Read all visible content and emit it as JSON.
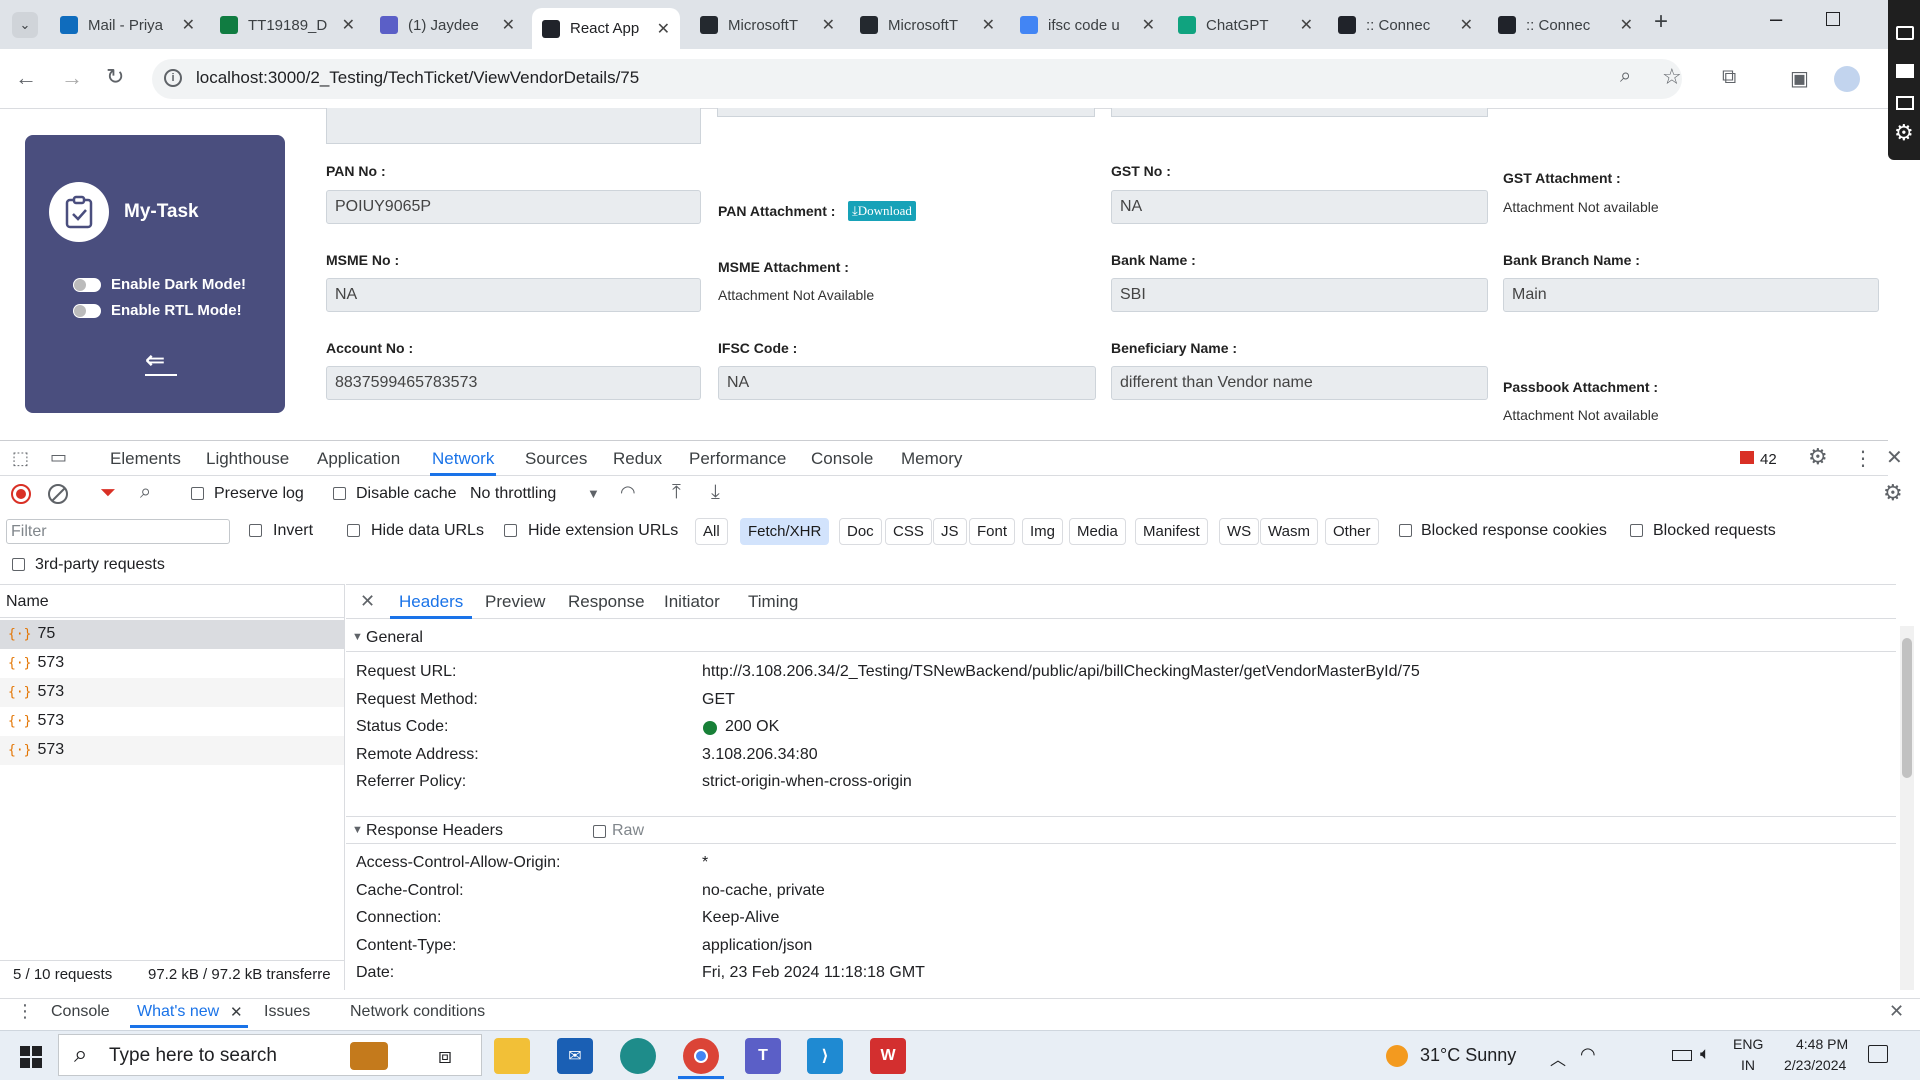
{
  "browser": {
    "tabs": [
      {
        "title": "Mail - Priya",
        "icon": "outlook-icon",
        "color": "#0f6cbd"
      },
      {
        "title": "TT19189_D",
        "icon": "excel-icon",
        "color": "#107c41"
      },
      {
        "title": "(1) Jaydee",
        "icon": "teams-icon",
        "color": "#5b5fc7"
      },
      {
        "title": "React App",
        "icon": "react-icon",
        "color": "#20232a",
        "active": true
      },
      {
        "title": "MicrosoftT",
        "icon": "github-icon",
        "color": "#24292f"
      },
      {
        "title": "MicrosoftT",
        "icon": "github-icon",
        "color": "#24292f"
      },
      {
        "title": "ifsc code u",
        "icon": "google-icon",
        "color": "#4285f4"
      },
      {
        "title": "ChatGPT",
        "icon": "chatgpt-icon",
        "color": "#10a37f"
      },
      {
        "title": ":: Connec",
        "icon": "react-icon",
        "color": "#20232a"
      },
      {
        "title": ":: Connec",
        "icon": "react-icon",
        "color": "#20232a"
      }
    ],
    "url": "localhost:3000/2_Testing/TechTicket/ViewVendorDetails/75"
  },
  "sidebar": {
    "title": "My-Task",
    "dark_mode": "Enable Dark Mode!",
    "rtl_mode": "Enable RTL Mode!"
  },
  "form": {
    "pan_label": "PAN No :",
    "pan_value": "POIUY9065P",
    "pan_attach_label": "PAN Attachment :",
    "download_label": "Download",
    "gst_label": "GST No :",
    "gst_value": "NA",
    "gst_attach_label": "GST Attachment :",
    "gst_attach_value": "Attachment Not available",
    "msme_label": "MSME No :",
    "msme_value": "NA",
    "msme_attach_label": "MSME Attachment :",
    "msme_attach_value": "Attachment Not Available",
    "bank_label": "Bank Name :",
    "bank_value": "SBI",
    "branch_label": "Bank Branch Name :",
    "branch_value": "Main",
    "account_label": "Account No :",
    "account_value": "8837599465783573",
    "ifsc_label": "IFSC Code :",
    "ifsc_value": "NA",
    "beneficiary_label": "Beneficiary Name :",
    "beneficiary_value": "different than Vendor name",
    "passbook_label": "Passbook Attachment :",
    "passbook_value": "Attachment Not available"
  },
  "devtools": {
    "tabs": [
      "Elements",
      "Lighthouse",
      "Application",
      "Network",
      "Sources",
      "Redux",
      "Performance",
      "Console",
      "Memory"
    ],
    "issues_count": "42",
    "preserve_log": "Preserve log",
    "disable_cache": "Disable cache",
    "throttling": "No throttling",
    "filter_placeholder": "Filter",
    "invert": "Invert",
    "hide_data_urls": "Hide data URLs",
    "hide_ext_urls": "Hide extension URLs",
    "type_filters": [
      "All",
      "Fetch/XHR",
      "Doc",
      "CSS",
      "JS",
      "Font",
      "Img",
      "Media",
      "Manifest",
      "WS",
      "Wasm",
      "Other"
    ],
    "blocked_cookies": "Blocked response cookies",
    "blocked_requests": "Blocked requests",
    "third_party": "3rd-party requests",
    "name_header": "Name",
    "requests": [
      "75",
      "573",
      "573",
      "573",
      "573"
    ],
    "status_bar": "5 / 10 requests",
    "transfer": "97.2 kB / 97.2 kB transferre",
    "detail_tabs": [
      "Headers",
      "Preview",
      "Response",
      "Initiator",
      "Timing"
    ],
    "general_title": "General",
    "general": [
      {
        "k": "Request URL:",
        "v": "http://3.108.206.34/2_Testing/TSNewBackend/public/api/billCheckingMaster/getVendorMasterById/75"
      },
      {
        "k": "Request Method:",
        "v": "GET"
      },
      {
        "k": "Status Code:",
        "v": "200 OK"
      },
      {
        "k": "Remote Address:",
        "v": "3.108.206.34:80"
      },
      {
        "k": "Referrer Policy:",
        "v": "strict-origin-when-cross-origin"
      }
    ],
    "response_headers_title": "Response Headers",
    "raw_label": "Raw",
    "response_headers": [
      {
        "k": "Access-Control-Allow-Origin:",
        "v": "*"
      },
      {
        "k": "Cache-Control:",
        "v": "no-cache, private"
      },
      {
        "k": "Connection:",
        "v": "Keep-Alive"
      },
      {
        "k": "Content-Type:",
        "v": "application/json"
      },
      {
        "k": "Date:",
        "v": "Fri, 23 Feb 2024 11:18:18 GMT"
      }
    ],
    "drawer_tabs": [
      "Console",
      "What's new",
      "Issues",
      "Network conditions"
    ]
  },
  "taskbar": {
    "search_placeholder": "Type here to search",
    "weather": "31°C  Sunny",
    "lang1": "ENG",
    "lang2": "IN",
    "time": "4:48 PM",
    "date": "2/23/2024"
  }
}
